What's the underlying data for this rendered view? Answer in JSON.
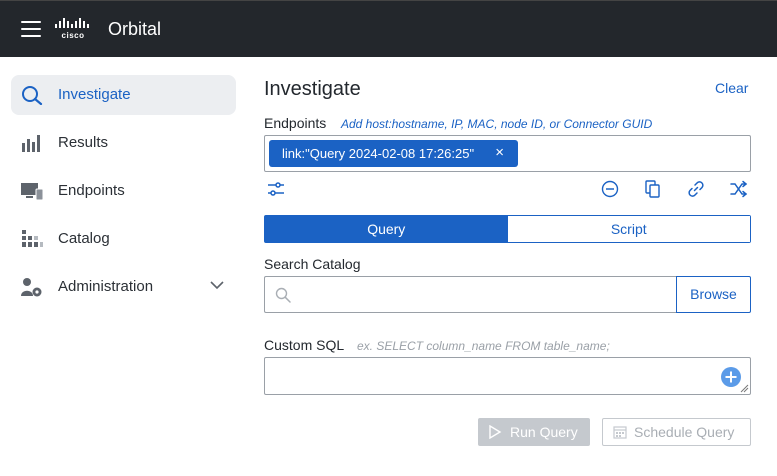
{
  "header": {
    "logo_text": "cisco",
    "app_title": "Orbital"
  },
  "sidebar": {
    "items": [
      {
        "label": "Investigate",
        "icon": "search-icon",
        "active": true
      },
      {
        "label": "Results",
        "icon": "bar-chart-icon",
        "active": false
      },
      {
        "label": "Endpoints",
        "icon": "monitor-icon",
        "active": false
      },
      {
        "label": "Catalog",
        "icon": "catalog-icon",
        "active": false
      },
      {
        "label": "Administration",
        "icon": "user-gear-icon",
        "active": false,
        "expandable": true
      }
    ]
  },
  "main": {
    "title": "Investigate",
    "clear_label": "Clear",
    "endpoints": {
      "label": "Endpoints",
      "hint": "Add host:hostname, IP, MAC, node ID, or Connector GUID",
      "chip": "link:\"Query 2024-02-08 17:26:25\"",
      "chip_close": "×"
    },
    "endpoint_tools": [
      "settings-sliders-icon",
      "remove-circle-icon",
      "copy-icon",
      "link-icon",
      "shuffle-icon"
    ],
    "mode_toggle": {
      "options": [
        "Query",
        "Script"
      ],
      "selected": "Query"
    },
    "catalog": {
      "label": "Search Catalog",
      "placeholder": "",
      "value": "",
      "browse_label": "Browse"
    },
    "custom_sql": {
      "label": "Custom SQL",
      "hint": "ex. SELECT column_name FROM table_name;",
      "value": ""
    },
    "actions": {
      "run_label": "Run Query",
      "schedule_label": "Schedule Query",
      "run_enabled": false,
      "schedule_enabled": false
    }
  },
  "colors": {
    "topbar": "#23272c",
    "accent": "#1b62c4",
    "active_nav_bg": "#eceef1",
    "disabled": "#c5c9ce"
  }
}
